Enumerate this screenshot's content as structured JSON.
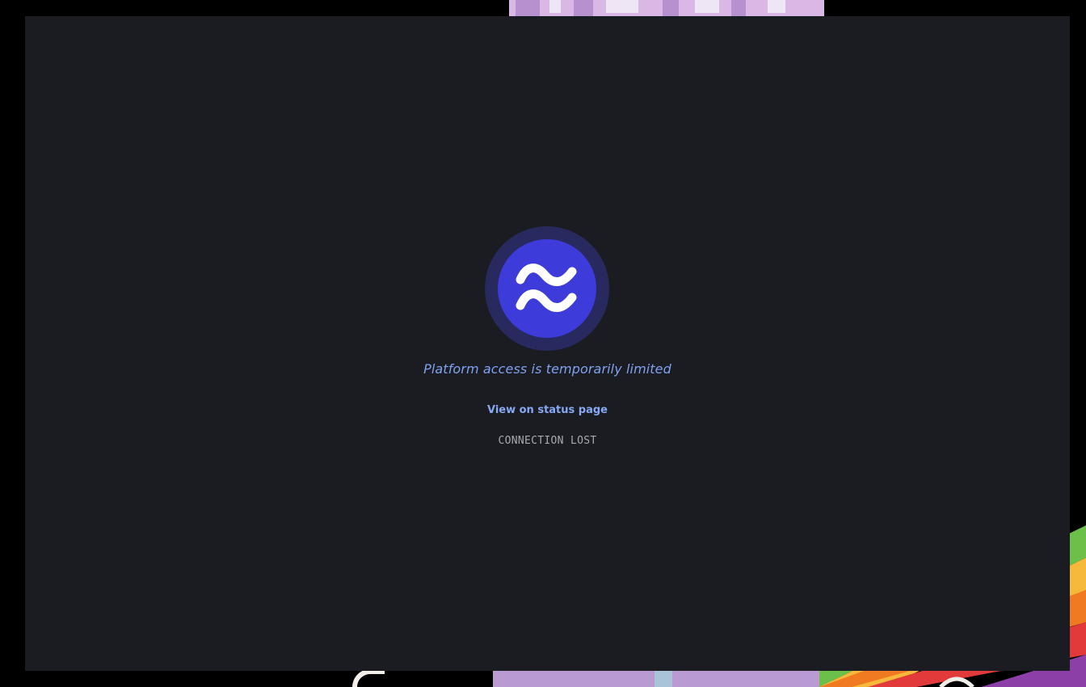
{
  "app": {
    "status_message": "Platform access is temporarily limited",
    "status_link_label": "View on status page",
    "connection_state": "CONNECTION LOST",
    "logo_icon": "approx-equal-waves-icon"
  },
  "colors": {
    "window_background": "#1b1c21",
    "logo_outer_ring": "#282a5f",
    "logo_disc": "#3d3bd9",
    "message_text": "#7ea2f0",
    "link_text": "#86a8f5",
    "state_text": "#a7a9b2",
    "desktop_background": "#000000"
  }
}
